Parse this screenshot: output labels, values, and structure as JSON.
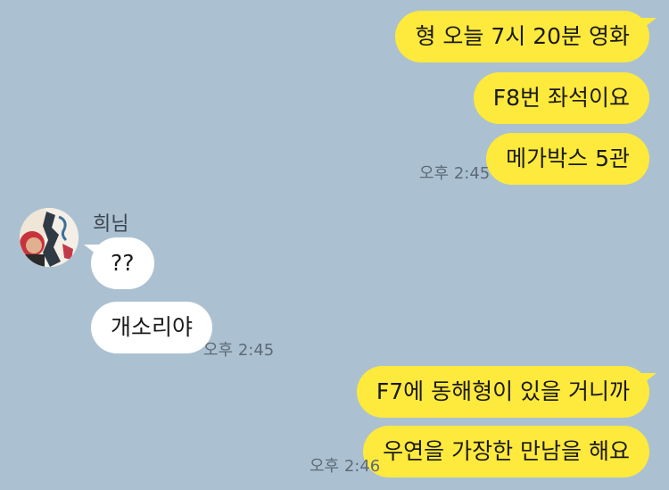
{
  "colors": {
    "background": "#abc1d1",
    "my_bubble": "#fee93d",
    "their_bubble": "#ffffff",
    "time_text": "#5d6b78"
  },
  "messages": {
    "m1": "형 오늘 7시 20분 영화",
    "m2": "F8번 좌석이요",
    "m3": "메가박스 5관",
    "t1": "오후 2:45",
    "sender_name": "희님",
    "r1": "??",
    "r2": "개소리야",
    "t2": "오후 2:45",
    "m4": "F7에 동해형이 있을 거니까",
    "m5": "우연을 가장한 만남을 해요",
    "t3": "오후 2:46"
  },
  "avatar_icon": "profile-photo-icon"
}
